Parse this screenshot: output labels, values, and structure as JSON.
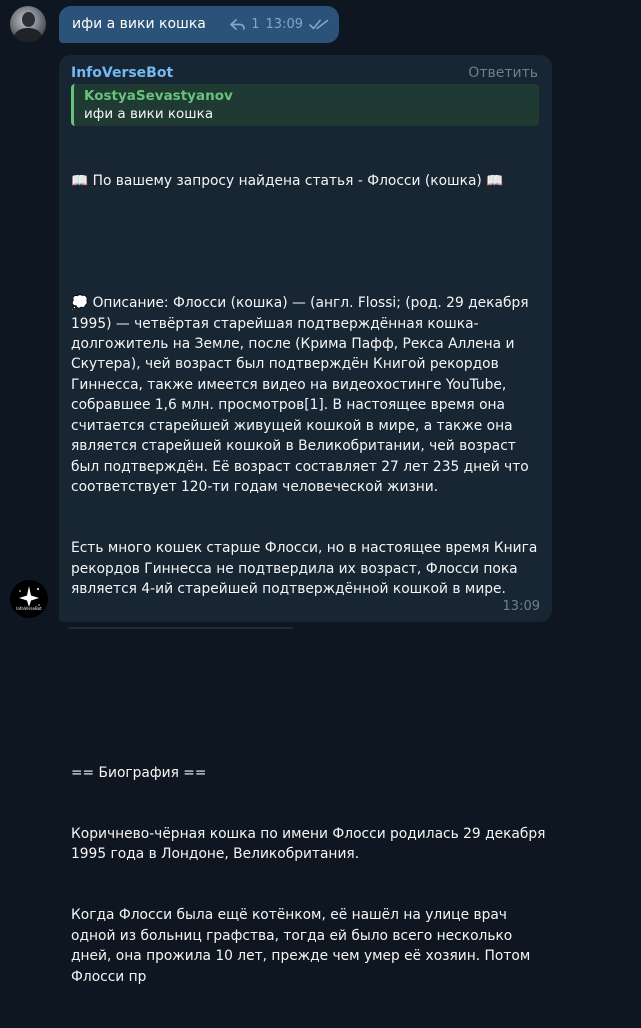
{
  "outgoing": {
    "text": "ифи а вики кошка",
    "reply_count": "1",
    "time": "13:09"
  },
  "bot_message": {
    "sender": "InfoVerseBot",
    "reply_label": "Ответить",
    "quote": {
      "author": "KostyaSevastyanov",
      "text": "ифи а вики кошка"
    },
    "paragraphs": [
      "📖 По вашему запросу найдена статья - Флосси (кошка) 📖",
      "",
      "💭 Описание: Флосси (кошка) — (англ. Flossi; (род. 29 декабря 1995) — четвёртая старейшая подтверждённая кошка-долгожитель на Земле, после (Крима Пафф, Рекса Аллена и Скутера), чей возраст был подтверждён Книгой рекордов Гиннесса, также имеется видео на видеохостинге YouTube, собравшее 1,6 млн. просмотров[1]. В настоящее время она считается старейшей живущей кошкой в мире, а также она является старейшей кошкой в Великобритании, чей возраст был подтверждён. Её возраст составляет 27 лет 235 дней что соответствует 120-ти годам человеческой жизни.",
      "Есть много кошек старше Флосси, но в настоящее время Книга рекордов Гиннесса не подтвердила их возраст, Флосси пока является 4-ий старейшей подтверждённой кошкой в мире.",
      "",
      "",
      "== Биография ==",
      "Коричнево-чёрная кошка по имени Флосси родилась 29 декабря 1995 года в Лондоне, Великобритания.",
      "Когда Флосси была ещё котёнком, её нашёл на улице врач одной из больниц графства, тогда ей было всего несколько дней, она прожила 10 лет, прежде чем умер её хозяин. Потом Флосси пр"
    ],
    "time": "13:09",
    "avatar_caption": "InfoVerseBot"
  }
}
